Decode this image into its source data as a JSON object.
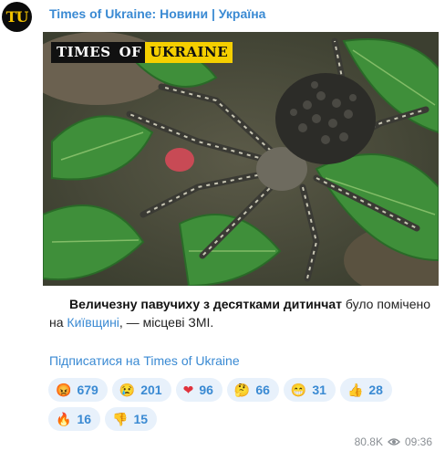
{
  "channel": {
    "avatar_text": "TU",
    "name": "Times of Ukraine: Новини | Україна"
  },
  "post": {
    "watermark_left": "TIMES",
    "watermark_mid": "OF",
    "watermark_right": "UKRAINE",
    "text_bold": "Величезну павучиху з десятками дитинчат",
    "text_part1": " було помічено на ",
    "text_link": "Київщині",
    "text_part2": ", — місцеві ЗМІ.",
    "subscribe": "Підписатися на Times of Ukraine"
  },
  "reactions": [
    {
      "icon": "angry-face-icon",
      "emoji": "😡",
      "count": "679"
    },
    {
      "icon": "crying-face-icon",
      "emoji": "😢",
      "count": "201"
    },
    {
      "icon": "red-heart-icon",
      "emoji": "❤",
      "count": "96"
    },
    {
      "icon": "thinking-face-icon",
      "emoji": "🤔",
      "count": "66"
    },
    {
      "icon": "grinning-face-icon",
      "emoji": "😁",
      "count": "31"
    },
    {
      "icon": "thumbs-up-icon",
      "emoji": "👍",
      "count": "28"
    },
    {
      "icon": "fire-icon",
      "emoji": "🔥",
      "count": "16"
    },
    {
      "icon": "thumbs-down-icon",
      "emoji": "👎",
      "count": "15"
    }
  ],
  "meta": {
    "views": "80.8K",
    "time": "09:36"
  },
  "colors": {
    "accent": "#3a8ad3",
    "reaction_bg": "#e8f1fb",
    "brand_yellow": "#f5cf00"
  }
}
